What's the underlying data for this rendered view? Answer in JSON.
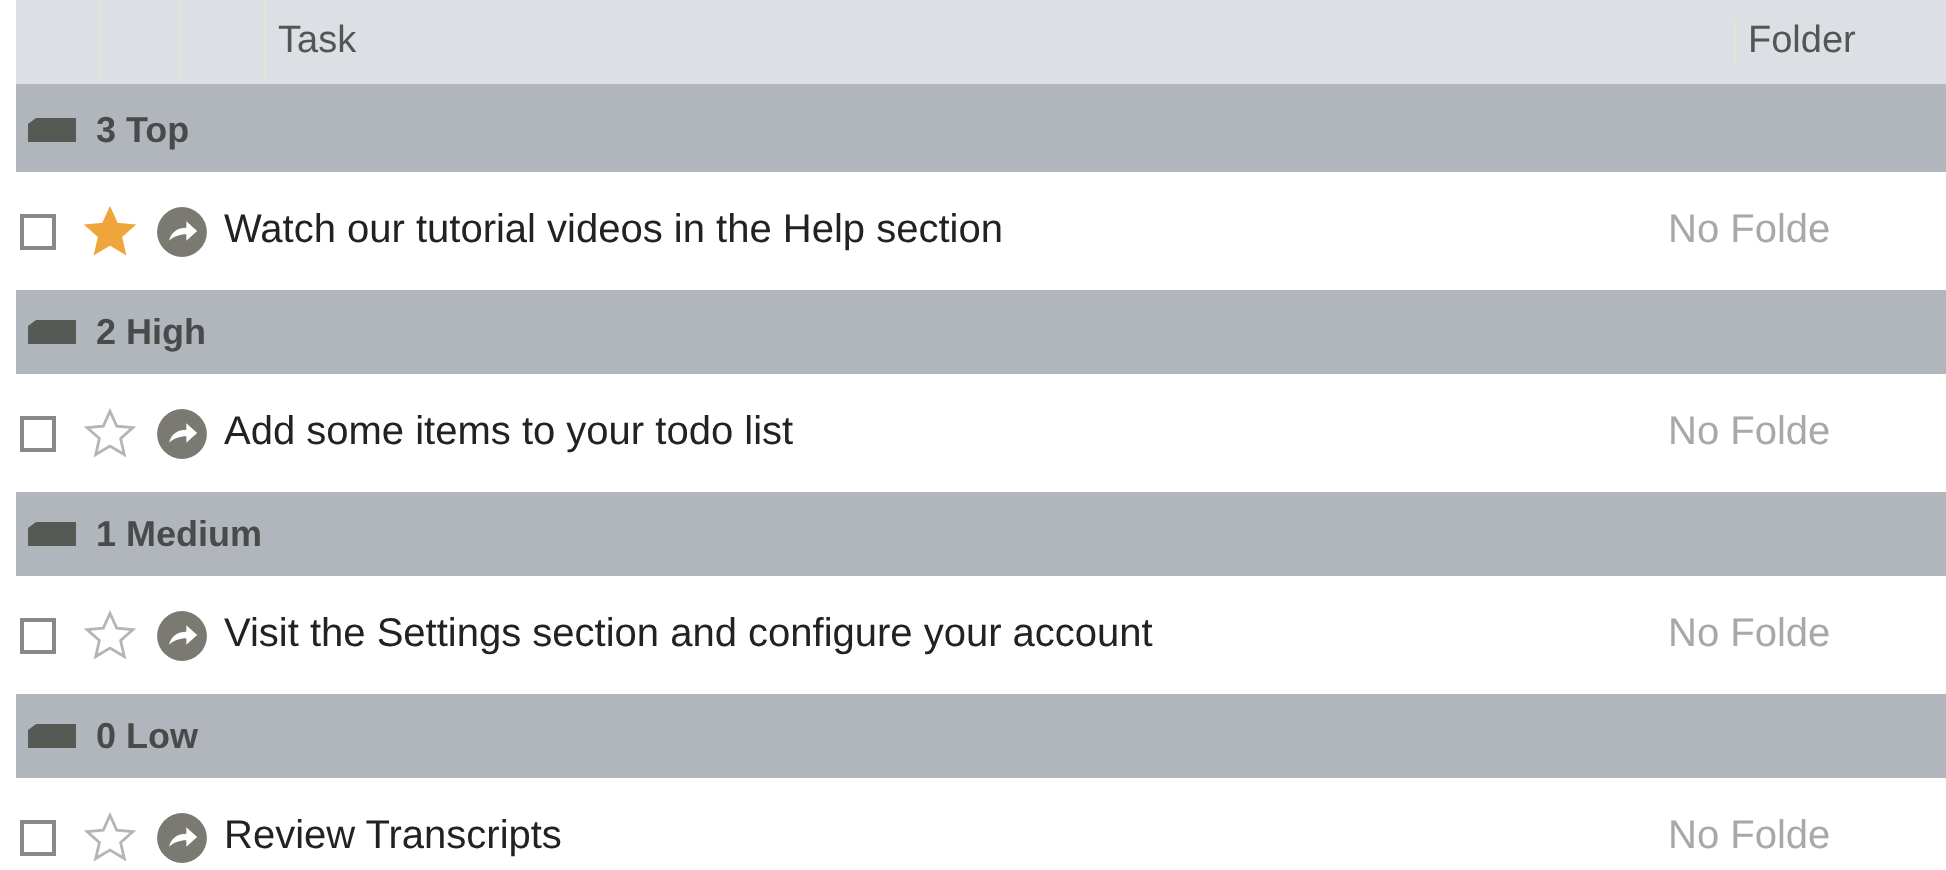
{
  "table": {
    "columns": [
      {
        "label": "Task"
      },
      {
        "label": "Folder"
      }
    ],
    "groups": [
      {
        "label": "3 Top",
        "tasks": [
          {
            "title": "Watch our tutorial videos in the Help section",
            "folder": "No Folde",
            "checked": false,
            "starred": true
          }
        ]
      },
      {
        "label": "2 High",
        "tasks": [
          {
            "title": "Add some items to your todo list",
            "folder": "No Folde",
            "checked": false,
            "starred": false
          }
        ]
      },
      {
        "label": "1 Medium",
        "tasks": [
          {
            "title": "Visit the Settings section and configure your account",
            "folder": "No Folde",
            "checked": false,
            "starred": false
          }
        ]
      },
      {
        "label": "0 Low",
        "tasks": [
          {
            "title": "Review Transcripts",
            "folder": "No Folde",
            "checked": false,
            "starred": false
          }
        ]
      }
    ]
  }
}
